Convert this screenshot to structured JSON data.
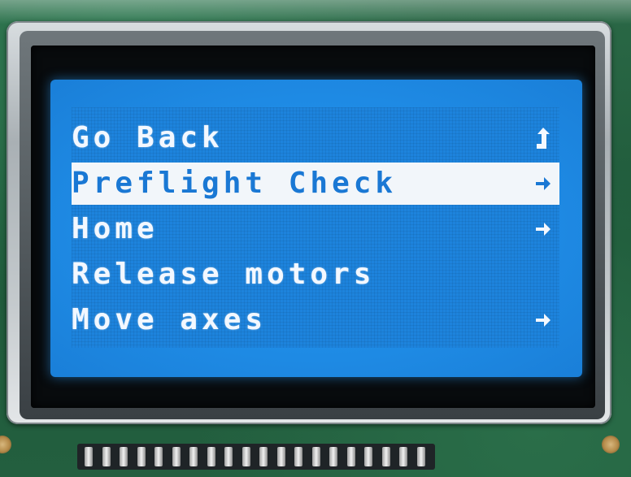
{
  "lcd": {
    "menu": [
      {
        "label": "Go Back",
        "icon": "up-return-arrow-icon",
        "selected": false
      },
      {
        "label": "Preflight Check",
        "icon": "right-arrow-icon",
        "selected": true
      },
      {
        "label": "Home",
        "icon": "right-arrow-icon",
        "selected": false
      },
      {
        "label": "Release motors",
        "icon": "",
        "selected": false
      },
      {
        "label": "Move axes",
        "icon": "right-arrow-icon",
        "selected": false
      }
    ]
  },
  "colors": {
    "backlight": "#1f8ce6",
    "text": "#f3f8ff",
    "selection_bg": "#f2f6fa",
    "selection_text": "#1a78d4"
  }
}
